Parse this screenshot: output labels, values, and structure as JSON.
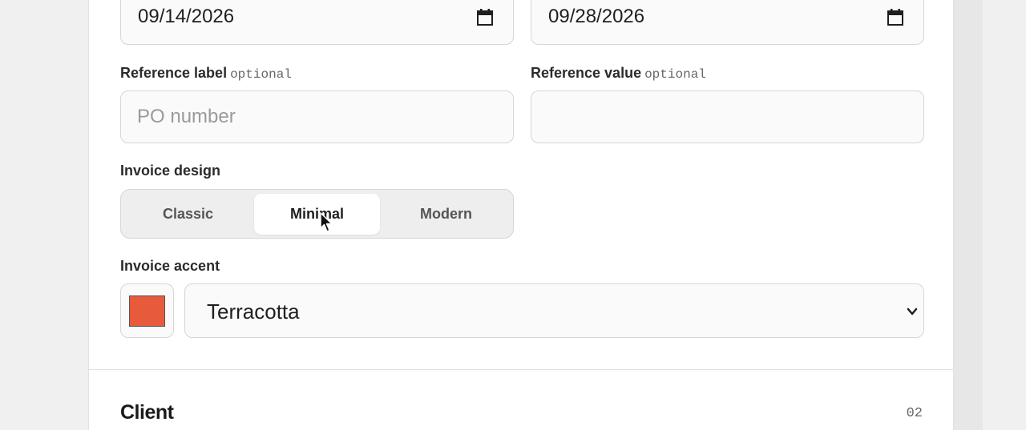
{
  "dates": {
    "start_value": "09/14/2026",
    "end_value": "09/28/2026",
    "icon": "calendar-icon"
  },
  "reference": {
    "label_title": "Reference label",
    "label_optional": "optional",
    "label_placeholder": "PO number",
    "label_value": "",
    "value_title": "Reference value",
    "value_optional": "optional",
    "value_value": ""
  },
  "design": {
    "title": "Invoice design",
    "options": [
      "Classic",
      "Minimal",
      "Modern"
    ],
    "selected": "Minimal"
  },
  "accent": {
    "title": "Invoice accent",
    "selected": "Terracotta",
    "color": "#e85a3c",
    "icon": "chevron-down-icon"
  },
  "client_section": {
    "title": "Client",
    "number": "02"
  }
}
